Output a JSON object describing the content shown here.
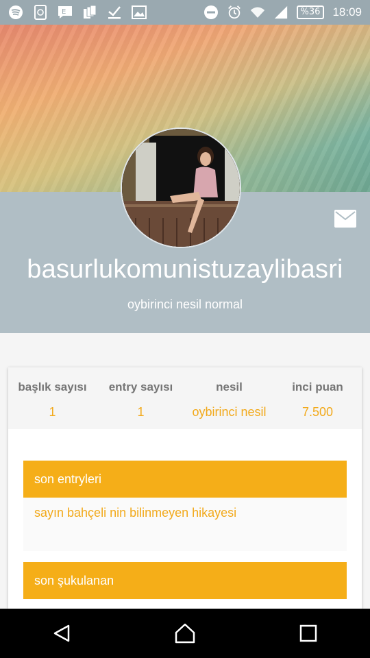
{
  "status_bar": {
    "time": "18:09",
    "battery": "%36",
    "left_icons": [
      "spotify-icon",
      "app-icon",
      "message-icon",
      "copy-icon",
      "check-icon",
      "image-icon"
    ],
    "right_icons": [
      "dnd-icon",
      "alarm-icon",
      "wifi-icon",
      "signal-icon",
      "battery-icon"
    ]
  },
  "profile": {
    "username": "basurlukomunistuzaylibasri",
    "generation": "oybirinci nesil normal"
  },
  "stats": [
    {
      "label": "başlık sayısı",
      "value": "1"
    },
    {
      "label": "entry sayısı",
      "value": "1"
    },
    {
      "label": "nesil",
      "value": "oybirinci nesil"
    },
    {
      "label": "inci puan",
      "value": "7.500"
    }
  ],
  "sections": {
    "recent_entries": {
      "title": "son entryleri",
      "items": [
        "sayın bahçeli nin bilinmeyen hikayesi"
      ]
    },
    "recent_upvoted": {
      "title": "son şukulanan"
    }
  },
  "colors": {
    "accent": "#f5ae18",
    "band": "#b0bec5"
  }
}
